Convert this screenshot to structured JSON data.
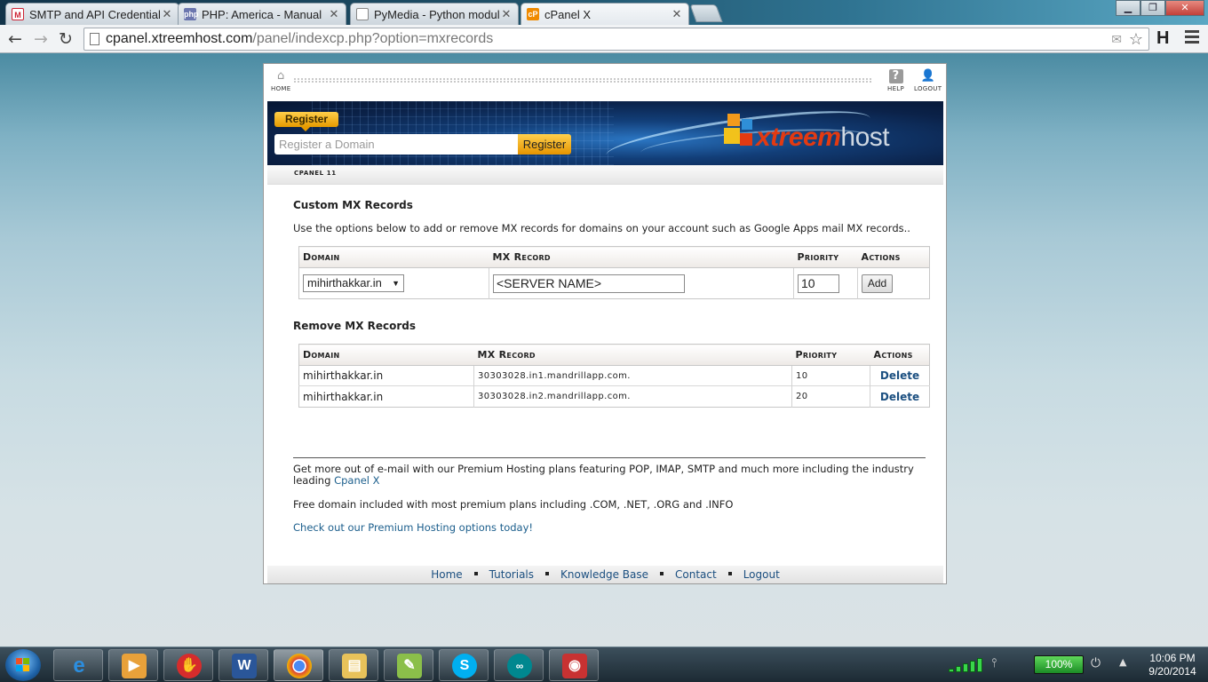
{
  "browser": {
    "tabs": [
      {
        "label": "SMTP and API Credentials",
        "favicon": "gmail-icon"
      },
      {
        "label": "PHP: America - Manual",
        "favicon": "php-icon"
      },
      {
        "label": "PyMedia - Python module",
        "favicon": "page-icon"
      },
      {
        "label": "cPanel X",
        "favicon": "cpanel-icon"
      }
    ],
    "address": {
      "host": "cpanel.xtreemhost.com",
      "path": "/panel/indexcp.php?option=mxrecords"
    },
    "h_button": "H"
  },
  "topbar": {
    "home": "HOME",
    "help": "HELP",
    "logout": "LOGOUT"
  },
  "banner": {
    "register_tag": "Register",
    "domain_placeholder": "Register a Domain",
    "register_button": "Register",
    "logo_x": "xtreem",
    "logo_host": "host"
  },
  "cpanel_label": "CPANEL 11",
  "custom": {
    "heading": "Custom MX Records",
    "description": "Use the options below to add or remove MX records for domains on your account such as Google Apps mail MX records..",
    "headers": {
      "domain": "Domain",
      "mx": "MX Record",
      "priority": "Priority",
      "actions": "Actions"
    },
    "domain_selected": "mihirthakkar.in",
    "mx_value": "<SERVER NAME>",
    "priority_value": "10",
    "add_label": "Add"
  },
  "remove": {
    "heading": "Remove MX Records",
    "headers": {
      "domain": "Domain",
      "mx": "MX Record",
      "priority": "Priority",
      "actions": "Actions"
    },
    "rows": [
      {
        "domain": "mihirthakkar.in",
        "mx": "30303028.in1.mandrillapp.com.",
        "priority": "10",
        "action": "Delete"
      },
      {
        "domain": "mihirthakkar.in",
        "mx": "30303028.in2.mandrillapp.com.",
        "priority": "20",
        "action": "Delete"
      }
    ]
  },
  "promo": {
    "line1": "Get more out of e-mail with our Premium Hosting plans featuring POP, IMAP, SMTP and much more including the industry",
    "line1b": "leading ",
    "line1_link": "Cpanel X",
    "line2": "Free domain included with most premium plans including .COM, .NET, .ORG and .INFO",
    "line3_link": "Check out our Premium Hosting options today!"
  },
  "footer": {
    "links": [
      "Home",
      "Tutorials",
      "Knowledge Base",
      "Contact",
      "Logout"
    ]
  },
  "taskbar": {
    "apps": [
      "ie-icon",
      "media-icon",
      "app-icon",
      "word-icon",
      "chrome-icon",
      "explorer-icon",
      "notepadpp-icon",
      "skype-icon",
      "arduino-icon",
      "camera-icon"
    ],
    "battery": "100%",
    "time": "10:06 PM",
    "date": "9/20/2014"
  },
  "colors": {
    "accent": "#e69a00",
    "link": "#1b4f80",
    "logo_red": "#e23a12"
  }
}
